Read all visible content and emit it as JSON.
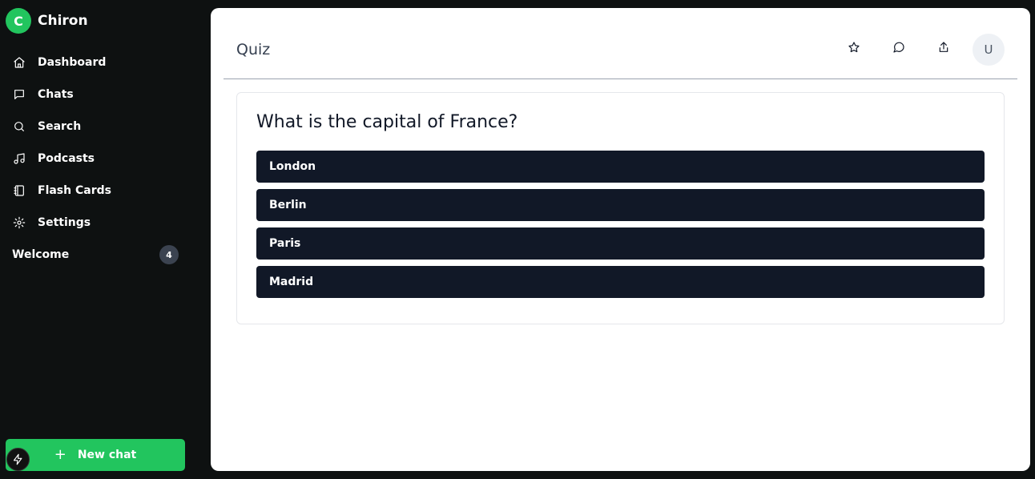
{
  "app": {
    "logo_letter": "C",
    "name": "Chiron"
  },
  "sidebar": {
    "items": [
      {
        "label": "Dashboard",
        "icon": "home-icon"
      },
      {
        "label": "Chats",
        "icon": "chat-icon"
      },
      {
        "label": "Search",
        "icon": "search-icon"
      },
      {
        "label": "Podcasts",
        "icon": "music-icon"
      },
      {
        "label": "Flash Cards",
        "icon": "notebook-icon"
      },
      {
        "label": "Settings",
        "icon": "gear-icon"
      }
    ],
    "welcome": {
      "label": "Welcome",
      "count": "4"
    },
    "new_chat": {
      "plus": "+",
      "label": "New chat"
    }
  },
  "header": {
    "title": "Quiz",
    "avatar_letter": "U",
    "actions": [
      "star-icon",
      "comment-icon",
      "share-icon"
    ]
  },
  "quiz": {
    "question": "What is the capital of France?",
    "options": [
      "London",
      "Berlin",
      "Paris",
      "Madrid"
    ]
  },
  "colors": {
    "sidebar_bg": "#0e1111",
    "accent": "#22c55e",
    "option_bg": "#111827"
  }
}
